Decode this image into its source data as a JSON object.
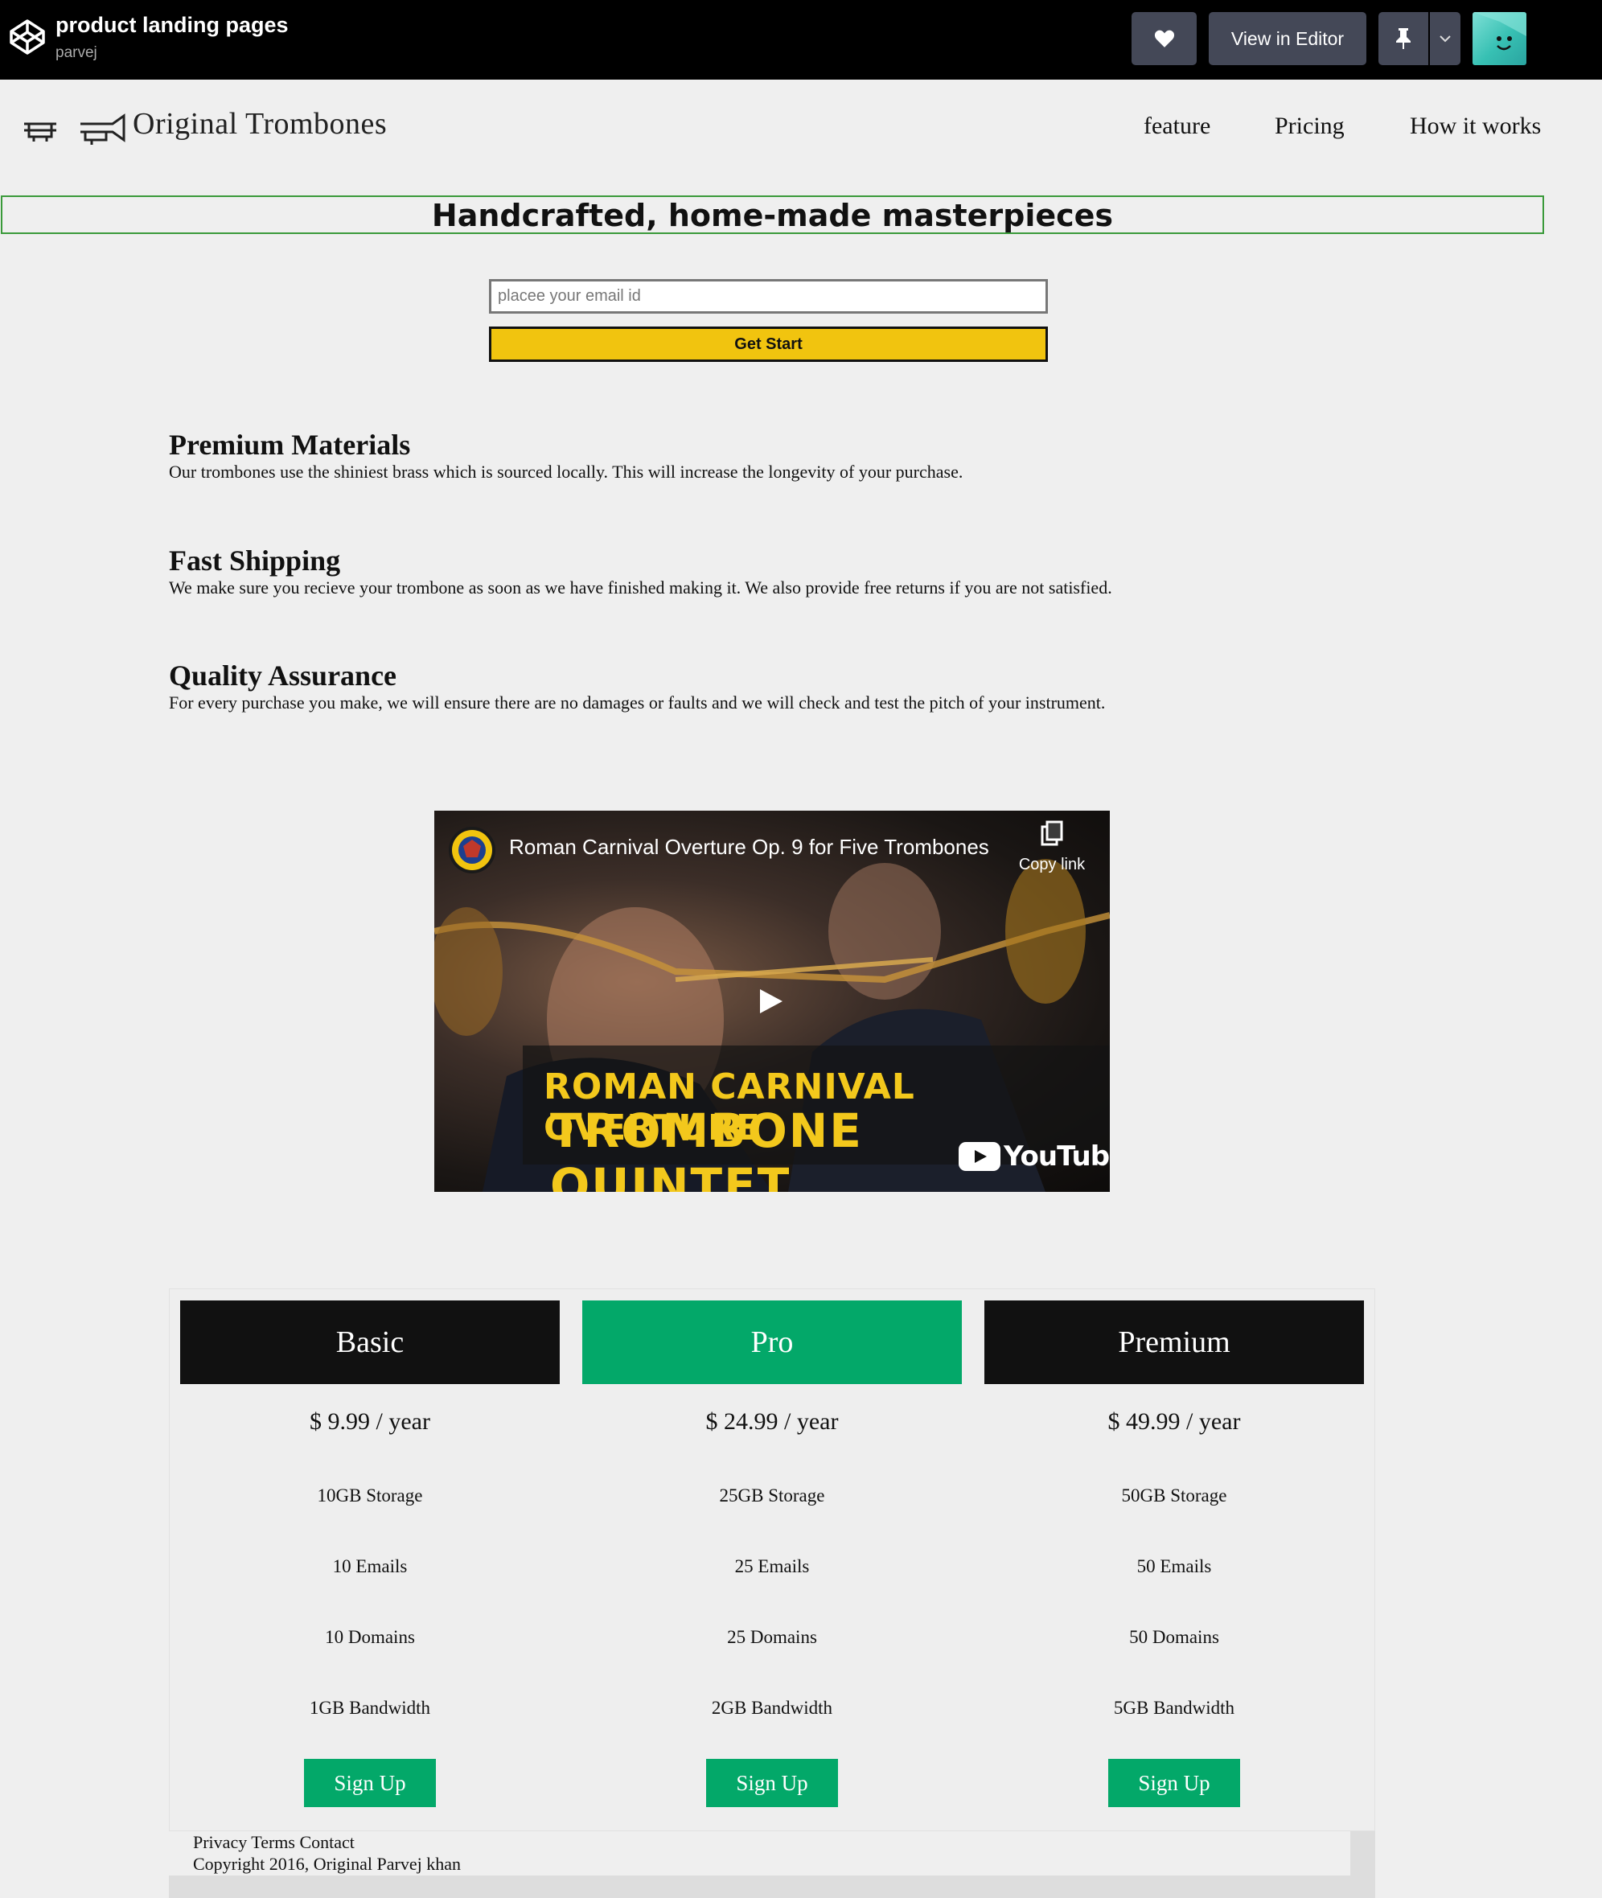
{
  "codepen": {
    "title": "product landing pages",
    "author": "parvej",
    "view_in_editor": "View in Editor"
  },
  "site": {
    "brand": "Original Trombones",
    "nav": [
      "feature",
      "Pricing",
      "How it works"
    ],
    "hero_title": "Handcrafted, home-made masterpieces",
    "email_placeholder": "placee your email id",
    "get_start": "Get Start"
  },
  "features": [
    {
      "title": "Premium Materials",
      "text": "Our trombones use the shiniest brass which is sourced locally. This will increase the longevity of your purchase."
    },
    {
      "title": "Fast Shipping",
      "text": "We make sure you recieve your trombone as soon as we have finished making it. We also provide free returns if you are not satisfied."
    },
    {
      "title": "Quality Assurance",
      "text": "For every purchase you make, we will ensure there are no damages or faults and we will check and test the pitch of your instrument."
    }
  ],
  "video": {
    "title": "Roman Carnival Overture Op. 9 for Five Trombones",
    "copy_link": "Copy link",
    "banner_line1": "ROMAN CARNIVAL OVERTURE",
    "banner_line2": "TROMBONE QUINTET",
    "youtube": "YouTube"
  },
  "plans": [
    {
      "name": "Basic",
      "price": "$ 9.99 / year",
      "color": "#111111",
      "features": [
        "10GB Storage",
        "10 Emails",
        "10 Domains",
        "1GB Bandwidth"
      ],
      "cta": "Sign Up"
    },
    {
      "name": "Pro",
      "price": "$ 24.99 / year",
      "color": "#03a869",
      "features": [
        "25GB Storage",
        "25 Emails",
        "25 Domains",
        "2GB Bandwidth"
      ],
      "cta": "Sign Up"
    },
    {
      "name": "Premium",
      "price": "$ 49.99 / year",
      "color": "#111111",
      "features": [
        "50GB Storage",
        "50 Emails",
        "50 Domains",
        "5GB Bandwidth"
      ],
      "cta": "Sign Up"
    }
  ],
  "footer": {
    "links": "Privacy Terms Contact",
    "copyright": "Copyright 2016, Original Parvej khan"
  }
}
